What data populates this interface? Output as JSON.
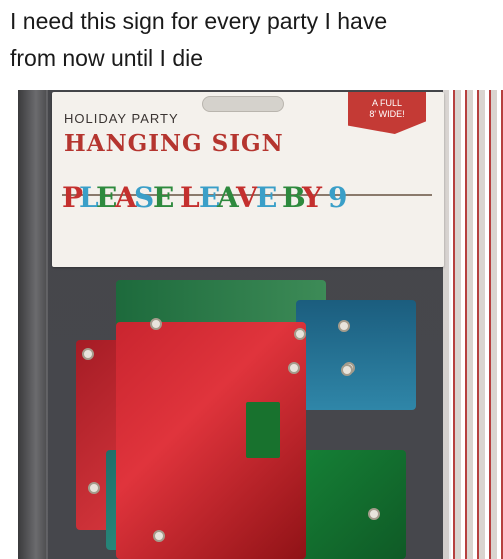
{
  "caption": {
    "line1": "I need this sign for every party I have",
    "line2": "from now until I die"
  },
  "photo": {
    "header_card": {
      "small_label": "HOLIDAY PARTY",
      "title": "HANGING SIGN",
      "badge_line1": "A FULL",
      "badge_line2": "8' WIDE!",
      "banner_letters": [
        {
          "char": "P",
          "color": "#c4302e"
        },
        {
          "char": "L",
          "color": "#3a9fc8"
        },
        {
          "char": "E",
          "color": "#2e8a3e"
        },
        {
          "char": "A",
          "color": "#c4302e"
        },
        {
          "char": "S",
          "color": "#3a9fc8"
        },
        {
          "char": "E",
          "color": "#2e8a3e"
        },
        {
          "char": "L",
          "color": "#c4302e"
        },
        {
          "char": "E",
          "color": "#3a9fc8"
        },
        {
          "char": "A",
          "color": "#2e8a3e"
        },
        {
          "char": "V",
          "color": "#c4302e"
        },
        {
          "char": "E",
          "color": "#3a9fc8"
        },
        {
          "char": "B",
          "color": "#2e8a3e"
        },
        {
          "char": "Y",
          "color": "#c4302e"
        },
        {
          "char": "9",
          "color": "#3a9fc8"
        }
      ]
    }
  }
}
